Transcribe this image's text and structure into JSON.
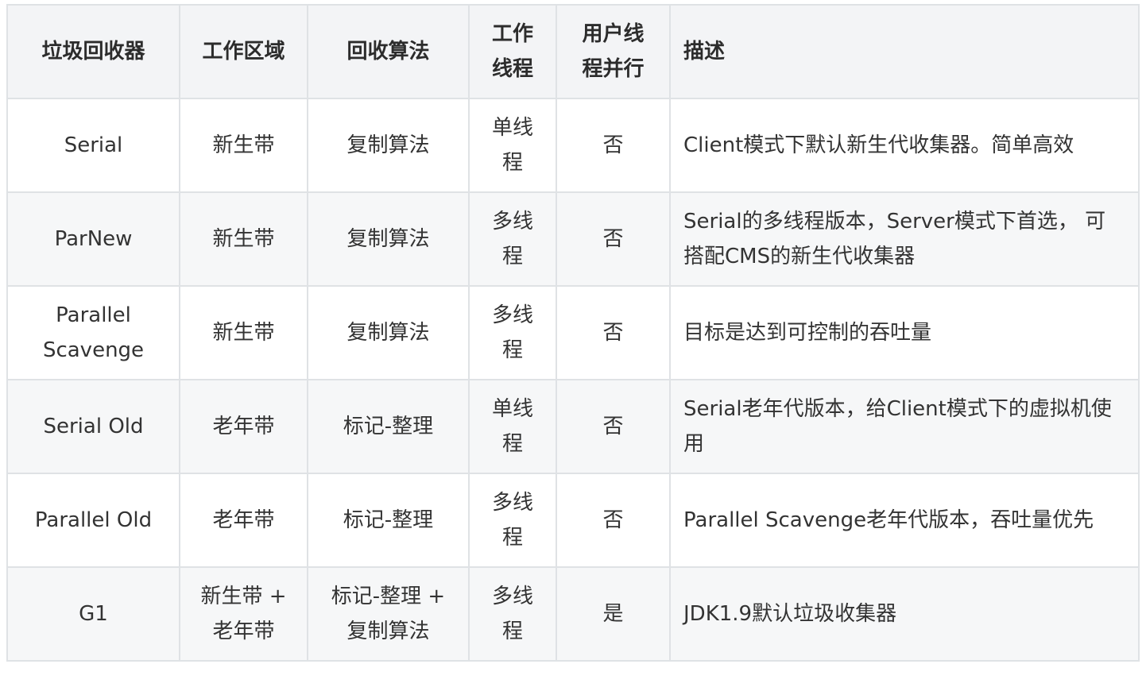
{
  "table": {
    "headers": [
      "垃圾回收器",
      "工作区域",
      "回收算法",
      "工作线程",
      "用户线程并行",
      "描述"
    ],
    "rows": [
      {
        "collector": "Serial",
        "area": "新生带",
        "algorithm": "复制算法",
        "threads": "单线程",
        "parallel": "否",
        "description": "Client模式下默认新生代收集器。简单高效"
      },
      {
        "collector": "ParNew",
        "area": "新生带",
        "algorithm": "复制算法",
        "threads": "多线程",
        "parallel": "否",
        "description": "Serial的多线程版本，Server模式下首选， 可搭配CMS的新生代收集器"
      },
      {
        "collector": "Parallel Scavenge",
        "area": "新生带",
        "algorithm": "复制算法",
        "threads": "多线程",
        "parallel": "否",
        "description": "目标是达到可控制的吞吐量"
      },
      {
        "collector": "Serial Old",
        "area": "老年带",
        "algorithm": "标记-整理",
        "threads": "单线程",
        "parallel": "否",
        "description": "Serial老年代版本，给Client模式下的虚拟机使用"
      },
      {
        "collector": "Parallel Old",
        "area": "老年带",
        "algorithm": "标记-整理",
        "threads": "多线程",
        "parallel": "否",
        "description": "Parallel Scavenge老年代版本，吞吐量优先"
      },
      {
        "collector": "G1",
        "area": "新生带 + 老年带",
        "algorithm": "标记-整理 + 复制算法",
        "threads": "多线程",
        "parallel": "是",
        "description": "JDK1.9默认垃圾收集器"
      }
    ]
  }
}
